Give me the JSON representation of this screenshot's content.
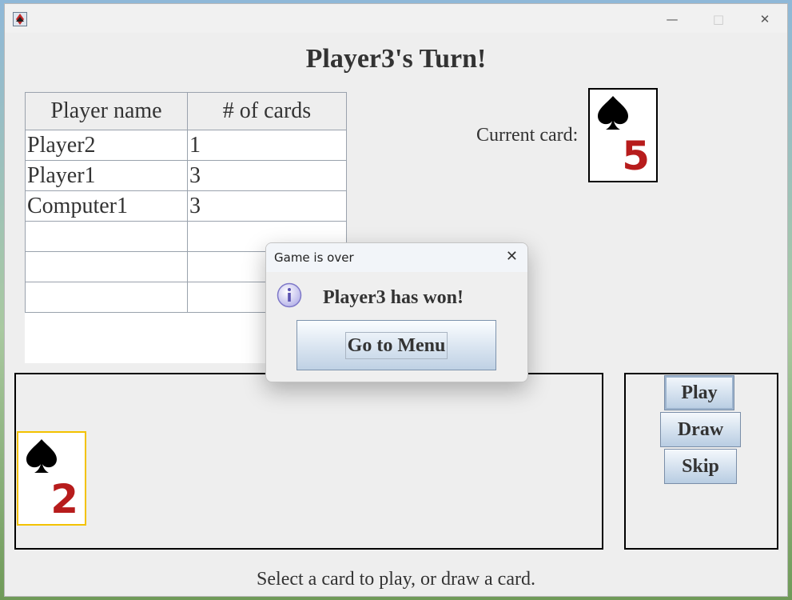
{
  "window": {
    "minimize_glyph": "—",
    "maximize_glyph": "□",
    "close_glyph": "✕"
  },
  "header": {
    "title": "Player3's Turn!"
  },
  "players_table": {
    "headers": [
      "Player name",
      "# of cards"
    ],
    "rows": [
      [
        "Player2",
        "1"
      ],
      [
        "Player1",
        "3"
      ],
      [
        "Computer1",
        "3"
      ],
      [
        "",
        ""
      ],
      [
        "",
        ""
      ],
      [
        "",
        ""
      ]
    ]
  },
  "current_card": {
    "label": "Current card:",
    "suit_icon": "spade-icon",
    "rank": "5"
  },
  "hand": {
    "cards": [
      {
        "suit_icon": "spade-icon",
        "rank": "2",
        "selected": true
      }
    ]
  },
  "actions": {
    "play_label": "Play",
    "draw_label": "Draw",
    "skip_label": "Skip"
  },
  "status": {
    "text": "Select a card to play, or draw a card."
  },
  "dialog": {
    "title": "Game is over",
    "close_glyph": "✕",
    "icon": "info-icon",
    "message": "Player3 has won!",
    "button_label": "Go to Menu"
  },
  "colors": {
    "rank_red": "#b71c1c",
    "selected_border": "#f3c200",
    "button_blue": "#d3e0ee"
  }
}
